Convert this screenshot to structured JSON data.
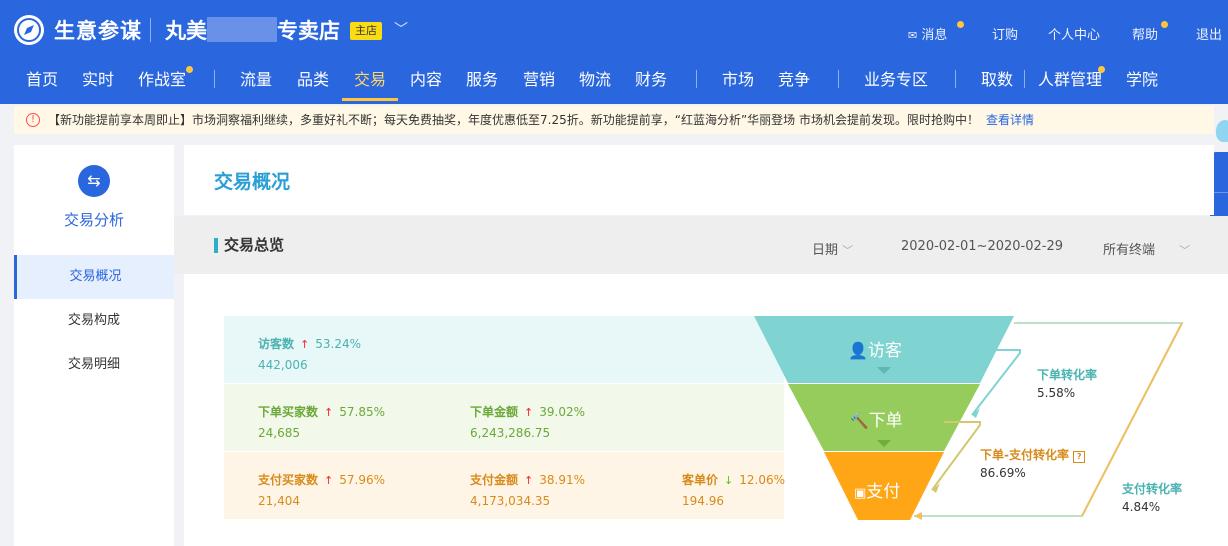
{
  "topbar": {
    "logo": "生意参谋",
    "shop_name_prefix": "丸美",
    "shop_name_suffix": "专卖店",
    "shop_badge": "主店",
    "links": [
      "消息",
      "订购",
      "个人中心",
      "帮助",
      "退出"
    ]
  },
  "nav": {
    "items": [
      "首页",
      "实时",
      "作战室",
      "流量",
      "品类",
      "交易",
      "内容",
      "服务",
      "营销",
      "物流",
      "财务",
      "市场",
      "竞争",
      "业务专区",
      "取数",
      "人群管理",
      "学院"
    ],
    "active": "交易"
  },
  "notice": {
    "text": "【新功能提前享本周即止】市场洞察福利继续，多重好礼不断；每天免费抽奖，年度优惠低至7.25折。新功能提前享，“红蓝海分析”华丽登场 市场机会提前发现。限时抢购中！",
    "link": "查看详情"
  },
  "sidebar": {
    "title": "交易分析",
    "items": [
      "交易概况",
      "交易构成",
      "交易明细"
    ],
    "active": "交易概况"
  },
  "page": {
    "title": "交易概况"
  },
  "section": {
    "title": "交易总览",
    "date_label": "日期",
    "date_range": "2020-02-01~2020-02-29",
    "terminal": "所有终端"
  },
  "metrics": {
    "visitors": {
      "label": "访客数",
      "pct": "53.24%",
      "value": "442,006",
      "trend": "up"
    },
    "order_buyers": {
      "label": "下单买家数",
      "pct": "57.85%",
      "value": "24,685",
      "trend": "up"
    },
    "order_amount": {
      "label": "下单金额",
      "pct": "39.02%",
      "value": "6,243,286.75",
      "trend": "up"
    },
    "pay_buyers": {
      "label": "支付买家数",
      "pct": "57.96%",
      "value": "21,404",
      "trend": "up"
    },
    "pay_amount": {
      "label": "支付金额",
      "pct": "38.91%",
      "value": "4,173,034.35",
      "trend": "up"
    },
    "unit_price": {
      "label": "客单价",
      "pct": "12.06%",
      "value": "194.96",
      "trend": "down"
    }
  },
  "funnel": {
    "stages": [
      "访客",
      "下单",
      "支付"
    ],
    "colors": [
      "#7fd3d0",
      "#95cc5c",
      "#ffa616"
    ]
  },
  "conversions": {
    "order_rate": {
      "label": "下单转化率",
      "value": "5.58%"
    },
    "order_pay_rate": {
      "label": "下单-支付转化率",
      "value": "86.69%"
    },
    "pay_rate": {
      "label": "支付转化率",
      "value": "4.84%"
    }
  },
  "colors": {
    "brand": "#2a66de",
    "accent": "#ffc53d",
    "up": "#f5222d",
    "down": "#52c41a",
    "row1_bg": "#e8f8f8",
    "row2_bg": "#f2f9ea",
    "row3_bg": "#fff5e6"
  }
}
